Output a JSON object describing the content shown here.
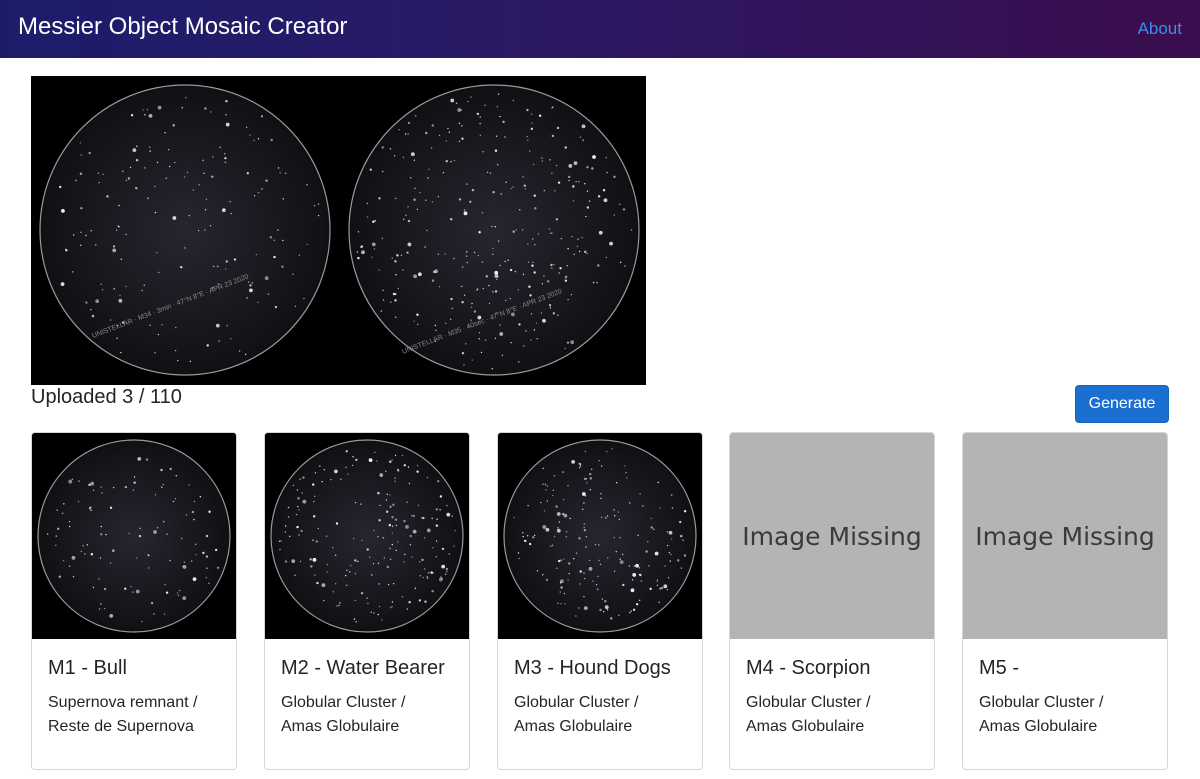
{
  "navbar": {
    "brand": "Messier Object Mosaic Creator",
    "about_label": "About"
  },
  "mosaic": {
    "images": [
      {
        "caption": "UNISTELLAR · M34 · 3min · 47°N 8°E · APR 23 2020"
      },
      {
        "caption": "UNISTELLAR · M35 · 40sec · 47°N 8°E · APR 23 2020"
      }
    ]
  },
  "status": {
    "uploaded_text": "Uploaded 3 / 110"
  },
  "actions": {
    "generate_label": "Generate"
  },
  "cards": [
    {
      "title": "M1 - Bull",
      "desc_line1": "Supernova remnant /",
      "desc_line2": "Reste de Supernova",
      "has_image": true,
      "missing_text": ""
    },
    {
      "title": "M2 - Water Bearer",
      "desc_line1": "Globular Cluster /",
      "desc_line2": "Amas Globulaire",
      "has_image": true,
      "missing_text": ""
    },
    {
      "title": "M3 - Hound Dogs",
      "desc_line1": "Globular Cluster /",
      "desc_line2": "Amas Globulaire",
      "has_image": true,
      "missing_text": ""
    },
    {
      "title": "M4 - Scorpion",
      "desc_line1": "Globular Cluster /",
      "desc_line2": "Amas Globulaire",
      "has_image": false,
      "missing_text": "Image Missing"
    },
    {
      "title": "M5 -",
      "desc_line1": "Globular Cluster /",
      "desc_line2": "Amas Globulaire",
      "has_image": false,
      "missing_text": "Image Missing"
    }
  ],
  "colors": {
    "navbar_start": "#1b1d6b",
    "navbar_end": "#3a0d4d",
    "link": "#3d8cf0",
    "button": "#1a6fd0",
    "missing_bg": "#b4b4b4"
  }
}
